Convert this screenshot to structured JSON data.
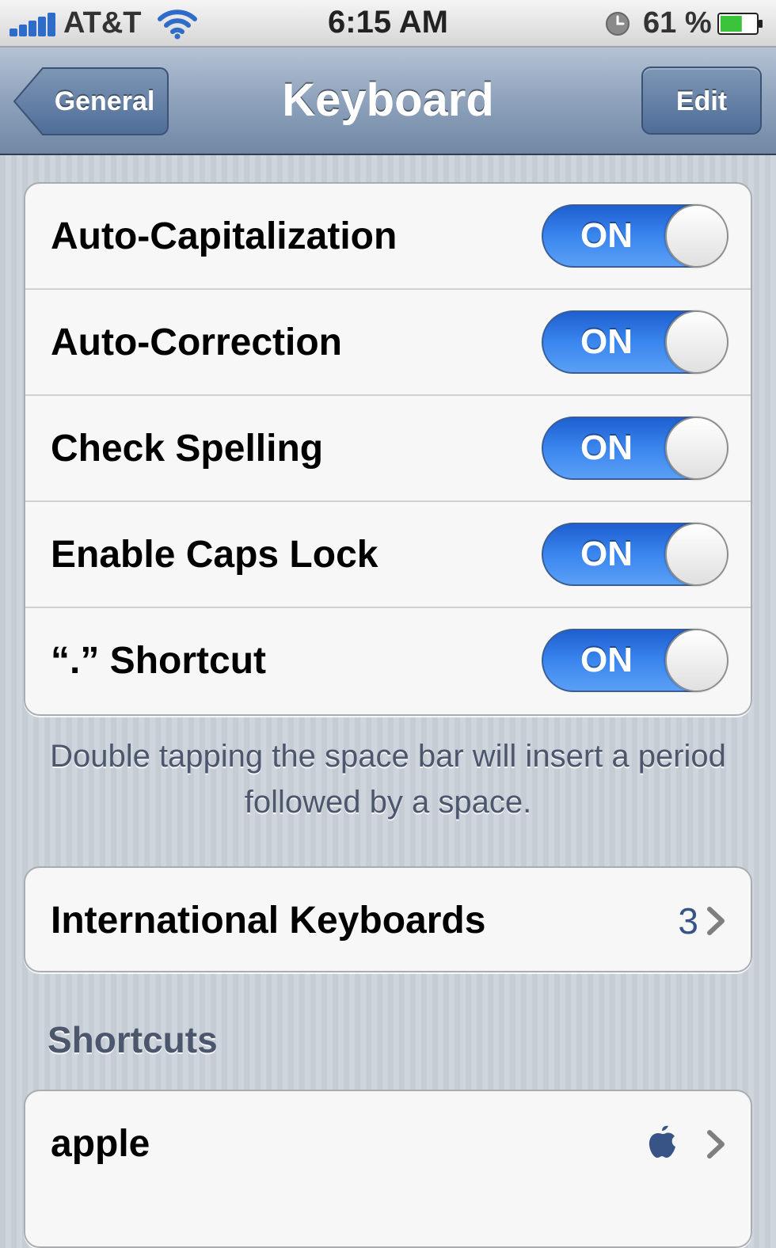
{
  "status_bar": {
    "carrier": "AT&T",
    "time": "6:15 AM",
    "battery_percent": "61 %",
    "battery_level": 0.61
  },
  "nav_bar": {
    "back_label": "General",
    "title": "Keyboard",
    "edit_label": "Edit"
  },
  "toggles": [
    {
      "label": "Auto-Capitalization",
      "state": "ON"
    },
    {
      "label": "Auto-Correction",
      "state": "ON"
    },
    {
      "label": "Check Spelling",
      "state": "ON"
    },
    {
      "label": "Enable Caps Lock",
      "state": "ON"
    },
    {
      "label": "“.” Shortcut",
      "state": "ON"
    }
  ],
  "footer_note": "Double tapping the space bar will insert a period followed by a space.",
  "international_keyboards": {
    "label": "International Keyboards",
    "count": "3"
  },
  "shortcuts": {
    "header": "Shortcuts",
    "items": [
      {
        "label": "apple",
        "icon": "apple-logo-icon"
      }
    ]
  },
  "colors": {
    "switch_on": "#2f7ae6",
    "nav_bar": "#8ea2bb",
    "detail_text": "#385487"
  }
}
